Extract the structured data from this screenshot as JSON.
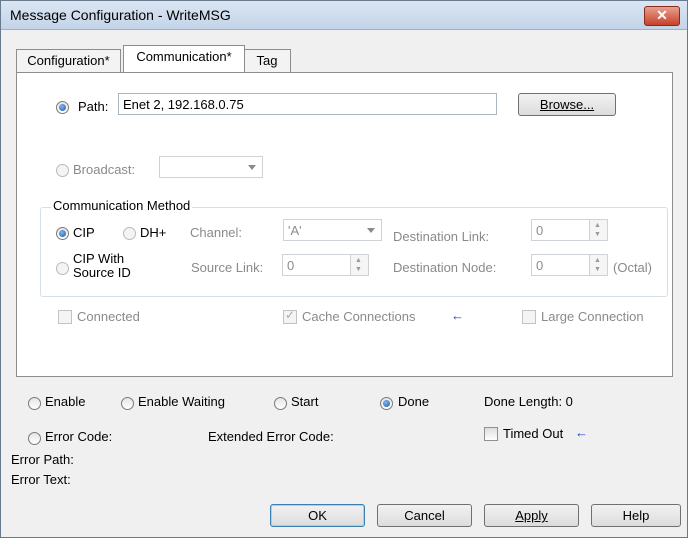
{
  "window": {
    "title": "Message Configuration - WriteMSG",
    "close_glyph": "✕"
  },
  "tabs": [
    "Configuration*",
    "Communication*",
    "Tag"
  ],
  "path": {
    "label": "Path:",
    "value": "Enet 2, 192.168.0.75",
    "browse": "Browse..."
  },
  "broadcast": {
    "label": "Broadcast:",
    "value": ""
  },
  "comm": {
    "group_label": "Communication Method",
    "cip": "CIP",
    "dhplus": "DH+",
    "cip_with_line1": "CIP With",
    "cip_with_line2": "Source ID",
    "channel_label": "Channel:",
    "channel_value": "'A'",
    "source_link_label": "Source Link:",
    "source_link_value": "0",
    "dest_link_label": "Destination Link:",
    "dest_link_value": "0",
    "dest_node_label": "Destination Node:",
    "dest_node_value": "0",
    "octal": "(Octal)"
  },
  "options": {
    "connected": "Connected",
    "cache": "Cache Connections",
    "large": "Large Connection",
    "arrow_glyph": "←"
  },
  "status": {
    "enable": "Enable",
    "enable_waiting": "Enable Waiting",
    "start": "Start",
    "done": "Done",
    "done_length": "Done Length: 0",
    "error_code": "Error Code:",
    "extended_error_code": "Extended Error Code:",
    "timed_out": "Timed Out",
    "error_path": "Error Path:",
    "error_text": "Error Text:"
  },
  "buttons": {
    "ok": "OK",
    "cancel": "Cancel",
    "apply": "Apply",
    "help": "Help"
  },
  "colors": {
    "accent_radio": "#1b57a7",
    "close_red": "#c8412a",
    "arrow_blue": "#1f3fbf"
  },
  "icons": {
    "close": "close-icon",
    "arrow": "left-arrow-icon"
  }
}
